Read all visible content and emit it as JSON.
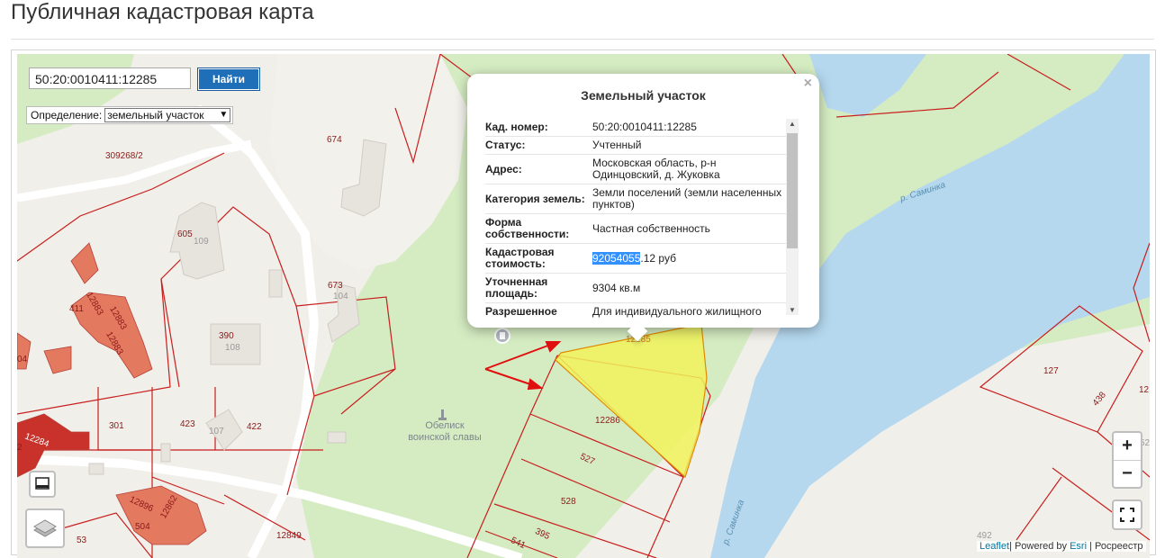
{
  "page": {
    "title": "Публичная кадастровая карта"
  },
  "search": {
    "value": "50:20:0010411:12285",
    "button_label": "Найти"
  },
  "definition": {
    "label": "Определение:",
    "selected": "земельный участок",
    "chevron": "chevron-down-icon"
  },
  "popup": {
    "title": "Земельный участок",
    "close": "×",
    "rows": [
      {
        "key": "Кад. номер:",
        "value": "50:20:0010411:12285"
      },
      {
        "key": "Статус:",
        "value": "Учтенный"
      },
      {
        "key": "Адрес:",
        "value": "Московская область, р-н Одинцовский, д. Жуковка"
      },
      {
        "key": "Категория земель:",
        "value": "Земли поселений (земли населенных пунктов)"
      },
      {
        "key": "Форма собственности:",
        "value": "Частная собственность"
      },
      {
        "key": "Кадастровая стоимость:",
        "value_highlight": "92054055",
        "value_rest": ".12 руб"
      },
      {
        "key": "Уточненная площадь:",
        "value": "9304 кв.м"
      },
      {
        "key": "Разрешенное",
        "value": "Для индивидуального жилищного"
      }
    ]
  },
  "map_labels": {
    "parcel_674": "674",
    "parcel_309268": "309268/2",
    "parcel_605": "605",
    "building_109": "109",
    "parcel_673": "673",
    "building_104": "104",
    "parcel_411": "411",
    "parcel_12883a": "12883",
    "parcel_12883b": "12883",
    "parcel_12883c": "12883",
    "parcel_390": "390",
    "building_108": "108",
    "parcel_12285": "12285",
    "parcel_12286": "12286",
    "parcel_527": "527",
    "parcel_528": "528",
    "parcel_395": "395",
    "parcel_541": "541",
    "parcel_301": "301",
    "parcel_423": "423",
    "building_107": "107",
    "parcel_422": "422",
    "parcel_12284": "12284",
    "parcel_12896": "12896",
    "parcel_12862": "12862",
    "parcel_504": "504",
    "parcel_53": "53",
    "parcel_12849": "12849",
    "parcel_127": "127",
    "parcel_438": "438",
    "parcel_12_edge": "12",
    "parcel_2_left": "2",
    "parcel_04_left": "04",
    "parcel_52_right": "52",
    "parcel_492": "492",
    "river_name_1": "р. Саминка",
    "river_name_2": "р. Саминка",
    "monument": "Обелиск воинской славы"
  },
  "controls": {
    "zoom_in": "+",
    "zoom_out": "−",
    "fullscreen": "fullscreen-icon",
    "layers": "layers-icon",
    "print": "print-icon"
  },
  "attribution": {
    "leaflet": "Leaflet",
    "powered": "| Powered by ",
    "esri": "Esri",
    "tail": " | Росреестр"
  },
  "colors": {
    "water": "#b5d8ef",
    "green": "#d5ecc2",
    "parcel_border": "#c81e1e",
    "selected_parcel": "#f1f35a",
    "building": "#e3795f",
    "button": "#1f6fb8"
  }
}
